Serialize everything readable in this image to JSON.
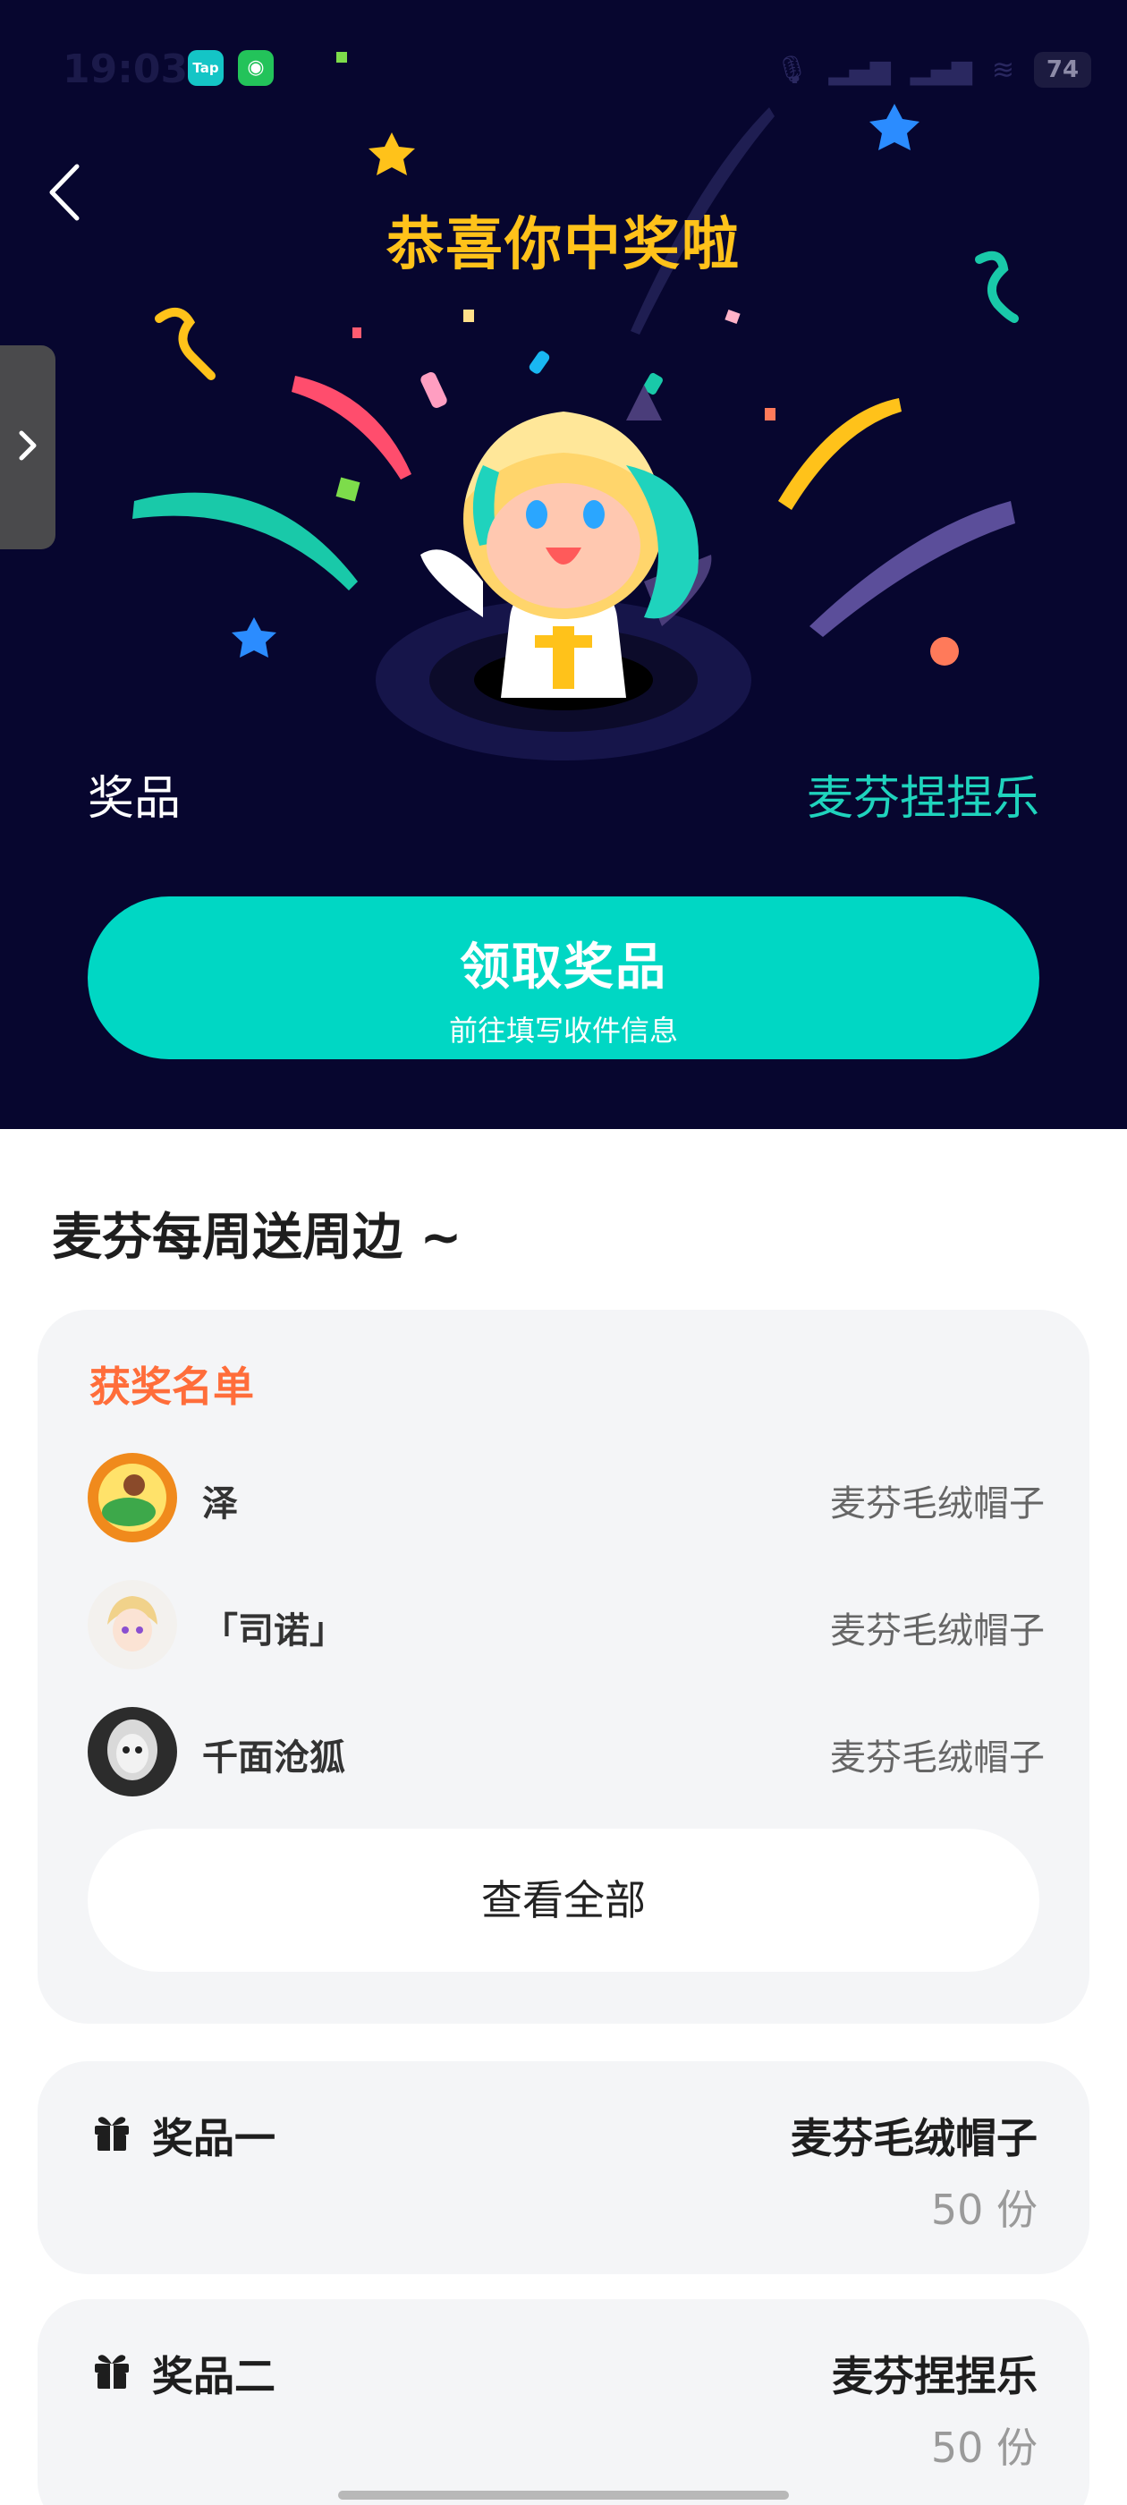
{
  "status_bar": {
    "time": "19:03",
    "tap_label": "Tap",
    "battery": "74"
  },
  "hero": {
    "title": "恭喜你中奖啦",
    "prize_label": "奖品",
    "prize_name": "麦芬捏捏乐",
    "claim_button": {
      "title": "领取奖品",
      "subtitle": "前往填写收件信息"
    }
  },
  "section": {
    "title": "麦芬每周送周边 ~"
  },
  "winners": {
    "heading": "获奖名单",
    "rows": [
      {
        "name": "泽",
        "prize": "麦芬毛绒帽子"
      },
      {
        "name": "「司诺」",
        "prize": "麦芬毛绒帽子"
      },
      {
        "name": "千面沧狐",
        "prize": "麦芬毛绒帽子"
      }
    ],
    "view_all": "查看全部"
  },
  "prizes": [
    {
      "title": "奖品一",
      "item": "麦芬毛绒帽子",
      "quantity": "50 份"
    },
    {
      "title": "奖品二",
      "item": "麦芬捏捏乐",
      "quantity": "50 份"
    }
  ],
  "colors": {
    "hero_bg": "#07062f",
    "title_gold": "#ffc21a",
    "accent_teal": "#00d7c4",
    "winners_orange": "#ff6d3a"
  }
}
